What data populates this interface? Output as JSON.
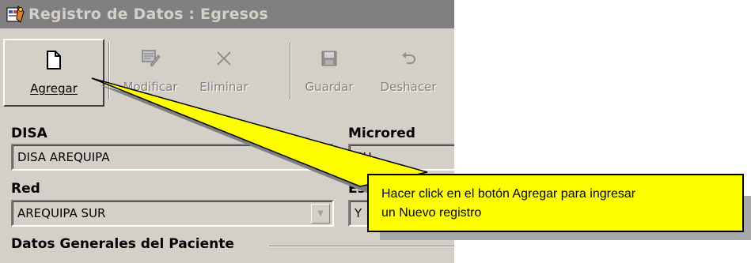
{
  "window": {
    "title": "Registro de Datos : Egresos"
  },
  "toolbar": {
    "buttons": [
      {
        "label": "Agregar",
        "icon": "new-document-icon",
        "state": "active"
      },
      {
        "label": "Modificar",
        "icon": "edit-icon",
        "state": "disabled"
      },
      {
        "label": "Eliminar",
        "icon": "delete-x-icon",
        "state": "disabled"
      },
      {
        "label": "Guardar",
        "icon": "save-disk-icon",
        "state": "disabled"
      },
      {
        "label": "Deshacer",
        "icon": "undo-icon",
        "state": "disabled"
      }
    ]
  },
  "form": {
    "disa": {
      "label": "DISA",
      "value": "DISA AREQUIPA"
    },
    "microred": {
      "label": "Microred",
      "value": "CH"
    },
    "red": {
      "label": "Red",
      "value": "AREQUIPA SUR"
    },
    "establecimiento": {
      "label": "Es",
      "value": "Y"
    },
    "group_title": "Datos Generales del Paciente"
  },
  "callout": {
    "line1": "Hacer click en el botón Agregar para ingresar",
    "line2": "un Nuevo registro",
    "color": "#ffff00"
  },
  "colors": {
    "window_bg": "#d4d0c8",
    "titlebar_bg": "#808080",
    "disabled_text": "#808080"
  }
}
